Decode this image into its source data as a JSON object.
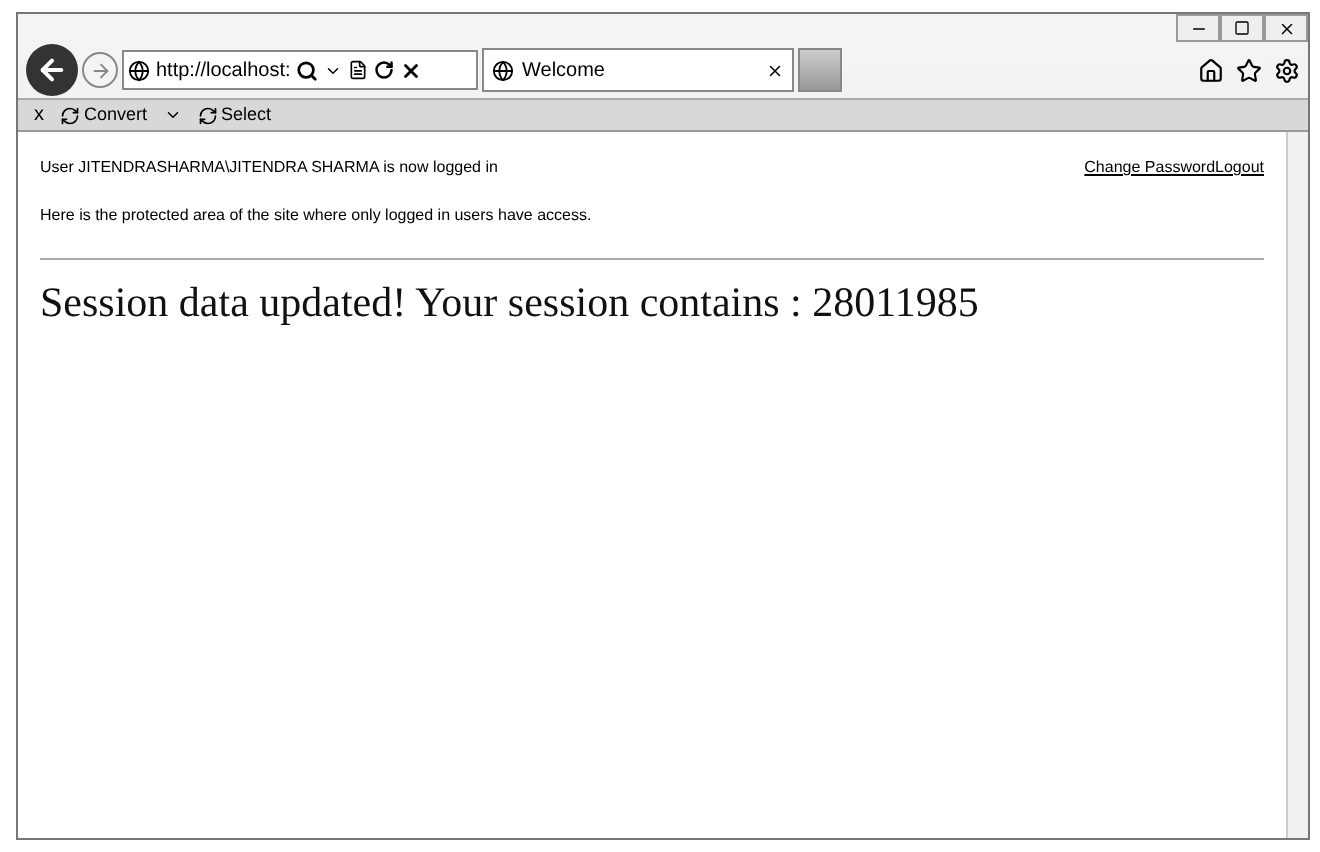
{
  "address_bar": {
    "url": "http://localhost:"
  },
  "tabs": [
    {
      "label": "Welcome",
      "selected": true
    }
  ],
  "toolbar": {
    "close": "x",
    "items": [
      {
        "label": "Convert",
        "has_menu": true
      },
      {
        "label": "Select",
        "has_menu": false
      }
    ]
  },
  "page": {
    "login_status": "User JITENDRASHARMA\\JITENDRA SHARMA is now logged in",
    "links": [
      "Change Password",
      "Logout"
    ],
    "notice": "Here is the protected area of the site where only logged in users have access.",
    "heading": "Session data updated! Your session contains : 28011985"
  }
}
